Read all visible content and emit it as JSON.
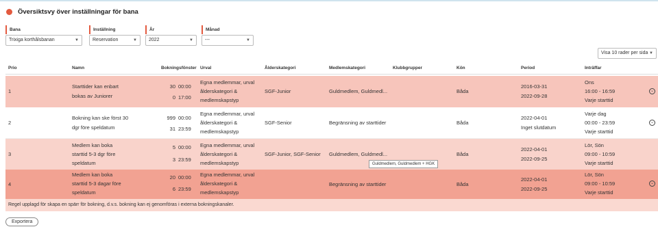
{
  "header": {
    "title": "Översiktsvy över inställningar för bana"
  },
  "filters": {
    "bana": {
      "label": "Bana",
      "value": "Trixiga korthålsbanan"
    },
    "installning": {
      "label": "Inställning",
      "value": "Reservation"
    },
    "ar": {
      "label": "År",
      "value": "2022"
    },
    "manad": {
      "label": "Månad",
      "value": "---"
    }
  },
  "page_size": "Visa 10 rader per sida",
  "columns": {
    "prio": "Prio",
    "namn": "Namn",
    "bokningsfonster": "Bokningsfönster",
    "urval": "Urval",
    "alderskategori": "Ålderskategori",
    "medlemskategori": "Medlemskategori",
    "klubbgrupper": "Klubbgrupper",
    "kon": "Kön",
    "period": "Period",
    "intraffar": "Inträffar"
  },
  "rows": [
    {
      "prio": "1",
      "namn": [
        "Starttider kan enbart",
        "bokas av Juniorer"
      ],
      "bf": [
        [
          "30",
          "00:00"
        ],
        [
          "0",
          "17:00"
        ]
      ],
      "urval": [
        "Egna medlemmar, urval",
        "ålderskategori &",
        "medlemskapstyp"
      ],
      "alder": "SGF-Junior",
      "medlem": "Guldmedlem, Guldmedl...",
      "kon": "Båda",
      "period": [
        "2016-03-31",
        "2022-09-28"
      ],
      "intraffar": [
        "Ons",
        "16:00 - 16:59",
        "Varje starttid"
      ]
    },
    {
      "prio": "2",
      "namn": [
        "Bokning kan ske först 30",
        "dgr före speldatum"
      ],
      "bf": [
        [
          "999",
          "00:00"
        ],
        [
          "31",
          "23:59"
        ]
      ],
      "urval": [
        "Egna medlemmar, urval",
        "ålderskategori &",
        "medlemskapstyp"
      ],
      "alder": "SGF-Senior",
      "medlem": "Begränsning av starttider",
      "kon": "Båda",
      "period": [
        "2022-04-01",
        "Inget slutdatum"
      ],
      "intraffar": [
        "Varje dag",
        "00:00 - 23:59",
        "Varje starttid"
      ]
    },
    {
      "prio": "3",
      "namn": [
        "Medlem kan boka",
        "starttid 5-3 dgr före",
        "speldatum"
      ],
      "bf": [
        [
          "5",
          "00:00"
        ],
        [
          "3",
          "23:59"
        ]
      ],
      "urval": [
        "Egna medlemmar, urval",
        "ålderskategori &",
        "medlemskapstyp"
      ],
      "alder": "SGF-Junior, SGF-Senior",
      "medlem": "Guldmedlem, Guldmedl...",
      "kon": "Båda",
      "period": [
        "2022-04-01",
        "2022-09-25"
      ],
      "intraffar": [
        "Lör, Sön",
        "09:00 - 10:59",
        "Varje starttid"
      ]
    },
    {
      "prio": "4",
      "namn": [
        "Medlem kan boka",
        "starttid 5-3 dagar före",
        "speldatum"
      ],
      "bf": [
        [
          "20",
          "00:00"
        ],
        [
          "6",
          "23:59"
        ]
      ],
      "urval": [
        "Egna medlemmar, urval",
        "ålderskategori &",
        "medlemskapstyp"
      ],
      "alder": "",
      "medlem": "Begränsning av starttider",
      "kon": "Båda",
      "period": [
        "2022-04-01",
        "2022-09-25"
      ],
      "intraffar": [
        "Lör, Sön",
        "09:00 - 10:59",
        "Varje starttid"
      ]
    }
  ],
  "tooltip": "Guldmedlem, Guldmedlem + HGK",
  "note": "Regel upplagd för skapa en spärr för bokning, d.v.s. bokning kan ej genomföras i externa bokningskanaler.",
  "export_label": "Exportera",
  "colors": {
    "accent": "#e35a3f",
    "row_highlight": "#f7c5bb",
    "row_selected": "#f2a292"
  }
}
